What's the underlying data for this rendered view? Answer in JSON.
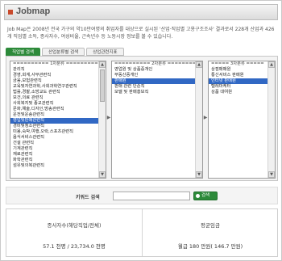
{
  "header": {
    "title": "Jobmap"
  },
  "intro": "Job Map은 2008년 전국 가구의 약10만여명의 취업자를 대상으로 실시된 '산업·직업별 고용구조조사' 결과로서 228개 산업과 426개 직업별 소득, 종사자수, 여성비율, 근속년수 등 노동시장 정보를 볼 수 있습니다.",
  "tabs": [
    {
      "label": "직업별 검색"
    },
    {
      "label": "산업분류별 검색"
    },
    {
      "label": "상업관련지표"
    }
  ],
  "lists": {
    "level1": {
      "header": "========== 1차분류 ==========",
      "items": [
        "관리직",
        "경영,회계,사무관련직",
        "금융,보험관련직",
        "교육및자연과학,사회과학연구관련직",
        "법률,경찰,소방교도 관련직",
        "보건,의료 관련직",
        "사회복지및 종교관련직",
        "문화,예술,디자인,방송관련직",
        "운전및운송관련직",
        "영업및판매관련직",
        "경비및청소관련직",
        "미용,숙박,여행,오락,스포츠관련직",
        "음식서비스관련직",
        "건설 관련직",
        "기계관련직",
        "재료관련직",
        "화학관련직",
        "섬유및의복관련직"
      ],
      "selected": "영업및판매관련직"
    },
    "level2": {
      "header": "========== 2차분류 ==========",
      "items": [
        "영업원 및 상품중개인",
        "부동산중개인",
        "판매원",
        "판매 관련 단순직",
        "모델 및 판매홍보직"
      ],
      "selected": "판매원"
    },
    "level3": {
      "header": "===== 3차분류 =====",
      "items": [
        "상점매매원",
        "통신서비스 판매원",
        "인터넷 판매원",
        "텔레마케터",
        "상품 대여원"
      ],
      "selected": "인터넷 판매원"
    }
  },
  "search": {
    "label": "키워드 검색",
    "placeholder": "",
    "button_label": "검색"
  },
  "stats": {
    "workers_label": "종사자수(해당직업/전체)",
    "workers_value": "57.1 천명 / 23,734.0 천명",
    "wage_label": "평균임금",
    "wage_value": "월급 180 만원( 146.7 만원)"
  },
  "colors": {
    "accent": "#2d8a3a",
    "selection": "#3168c4",
    "title_bullet": "#c94a2c"
  }
}
